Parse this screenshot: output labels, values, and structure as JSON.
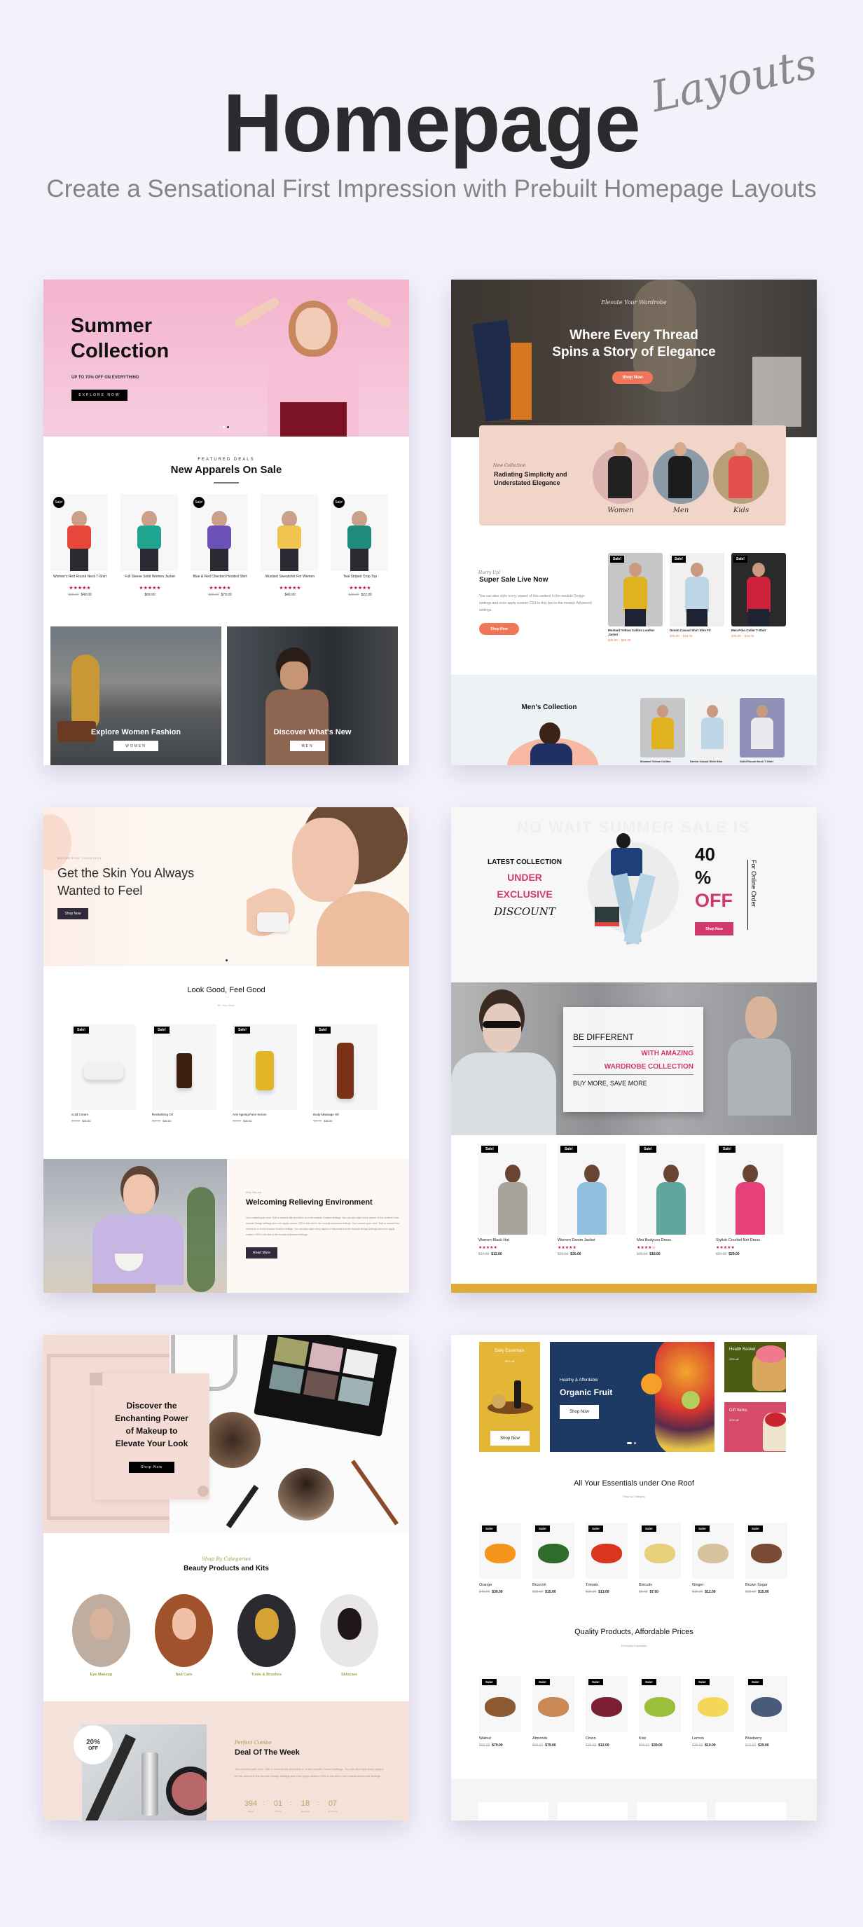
{
  "header": {
    "title": "Homepage",
    "script_word": "Layouts",
    "subtitle": "Create a Sensational First Impression with Prebuilt Homepage Layouts"
  },
  "layout1": {
    "hero": {
      "title_line1": "Summer",
      "title_line2": "Collection",
      "tagline": "UP TO 70% OFF ON EVERYTHING",
      "button": "EXPLORE NOW"
    },
    "featured_eyebrow": "FEATURED DEALS",
    "featured_title": "New Apparels On Sale",
    "products": [
      {
        "name": "Women's Red Round Neck T-Shirt",
        "old_price": "$59.00",
        "price": "$49.00",
        "sale": true,
        "stars": "★★★★★"
      },
      {
        "name": "Full Sleeve Solid Women Jacket",
        "old_price": "",
        "price": "$69.00",
        "sale": false,
        "stars": "★★★★★"
      },
      {
        "name": "Blue & Red Checked Hooded Shirt",
        "old_price": "$89.00",
        "price": "$79.00",
        "sale": true,
        "stars": "★★★★★"
      },
      {
        "name": "Mustard Sweatshirt For Women",
        "old_price": "",
        "price": "$49.00",
        "sale": false,
        "stars": "★★★★★"
      },
      {
        "name": "Teal Striped Crop Top",
        "old_price": "$30.00",
        "price": "$22.00",
        "sale": true,
        "stars": "★★★★★"
      }
    ],
    "sale_badge": "Sale!",
    "banners": [
      {
        "title": "Explore Women Fashion",
        "button": "WOMEN"
      },
      {
        "title": "Discover What's New",
        "button": "MEN"
      }
    ]
  },
  "layout2": {
    "hero": {
      "script": "Elevate Your Wardrobe",
      "title_line1": "Where Every Thread",
      "title_line2": "Spins a Story of Elegance",
      "button": "Shop Now"
    },
    "collection": {
      "script": "New Collection",
      "title_line1": "Radiating Simplicity and",
      "title_line2": "Understated Elegance",
      "categories": [
        "Women",
        "Men",
        "Kids"
      ]
    },
    "sale": {
      "script": "Hurry Up!",
      "title": "Super Sale Live Now",
      "body": "You can also style every aspect of this content in the module Design settings and even apply custom CSS to this text in the module Advanced settings.",
      "button": "Shop Now",
      "products": [
        {
          "name": "Mustard Yellow Collins Leather Jacket",
          "price": "$39.00 – $49.00"
        },
        {
          "name": "Denim Casual Shirt Slim Fit",
          "price": "$39.00 – $49.00"
        },
        {
          "name": "Men Polo Collar T-Shirt",
          "price": "$39.00 – $49.00"
        }
      ]
    },
    "mens": {
      "title": "Men's Collection",
      "products": [
        "Mustard Yellow Collins",
        "Denim Casual Shirt Slim",
        "Solid Round Neck T-Shirt"
      ]
    }
  },
  "layout3": {
    "hero": {
      "eyebrow": "MESMERIZE YOURSELF",
      "title_line1": "Get the Skin You Always",
      "title_line2": "Wanted to Feel",
      "button": "Shop Now"
    },
    "section_title": "Look Good, Feel Good",
    "section_sub": "Be Your Best!",
    "products": [
      {
        "name": "Cold Cream",
        "old_price": "$40.00",
        "price": "$30.00"
      },
      {
        "name": "Revitalizing Oil",
        "old_price": "$40.00",
        "price": "$30.00"
      },
      {
        "name": "Anti Ageing Face Serum",
        "old_price": "$40.00",
        "price": "$30.00"
      },
      {
        "name": "Body Massage Oil",
        "old_price": "$40.00",
        "price": "$30.00"
      }
    ],
    "about": {
      "eyebrow": "Who We Are",
      "title": "Welcoming Relieving Environment",
      "body": "Your content goes here. Edit or remove this text inline or in the module Content settings. You can also style every aspect of this content in the module Design settings and even apply custom CSS to this text in the module Advanced settings. Your content goes here. Edit or remove this text inline or in the module Content settings. You can also style every aspect of this content in the module Design settings and even apply custom CSS to this text in the module Advanced settings.",
      "button": "Read More"
    }
  },
  "layout4": {
    "hero": {
      "bg_text": "NO WAIT SUMMER SALE IS",
      "latest": "LATEST COLLECTION",
      "under": "UNDER",
      "exclusive": "EXCLUSIVE",
      "discount": "DISCOUNT",
      "percent": "40",
      "percent_sign": "%",
      "off": "OFF",
      "button": "Shop Now",
      "vertical": "For Online Order"
    },
    "promo": {
      "line1": "BE DIFFERENT",
      "line2": "WITH AMAZING",
      "line3": "WARDROBE COLLECTION",
      "line4": "BUY MORE, SAVE MORE"
    },
    "products": [
      {
        "name": "Women Black Hat",
        "old_price": "$17.00",
        "price": "$12.00",
        "stars": "★★★★★"
      },
      {
        "name": "Women Denim Jacket",
        "old_price": "$29.00",
        "price": "$20.00",
        "stars": "★★★★★"
      },
      {
        "name": "Mini Bodycon Dress",
        "old_price": "$25.00",
        "price": "$18.00",
        "stars": "★★★★☆"
      },
      {
        "name": "Stylish Crochet Net Dress",
        "old_price": "$34.00",
        "price": "$29.00",
        "stars": "★★★★★"
      }
    ]
  },
  "layout5": {
    "hero": {
      "title_line1": "Discover the",
      "title_line2": "Enchanting Power",
      "title_line3": "of Makeup to",
      "title_line4": "Elevate Your Look",
      "button": "Shop Now"
    },
    "categories_script": "Shop By Categories",
    "categories_title": "Beauty Products and Kits",
    "categories": [
      "Eye Makeup",
      "Nail Care",
      "Tools & Brushes",
      "Skincare"
    ],
    "deal": {
      "badge_pct": "20%",
      "badge_off": "OFF",
      "script": "Perfect Combo",
      "title": "Deal Of The Week",
      "body": "Your content goes here. Edit or remove this text inline or in the module Content settings. You can also style every aspect of this content in the module Design settings and even apply custom CSS to this text in the module Advanced settings.",
      "countdown": [
        {
          "value": "394",
          "label": "Day(s)"
        },
        {
          "value": "01",
          "label": "Hour(s)"
        },
        {
          "value": "18",
          "label": "Minute(s)"
        },
        {
          "value": "07",
          "label": "Second(s)"
        }
      ]
    }
  },
  "layout6": {
    "promo_left": {
      "title": "Daily Essentials",
      "discount": "50% off",
      "button": "Shop Now"
    },
    "promo_center": {
      "eyebrow": "Healthy & Affordable",
      "title": "Organic Fruit",
      "button": "Shop Now"
    },
    "promo_right_top": {
      "title": "Health Basket",
      "discount": "25% off"
    },
    "promo_right_bottom": {
      "title": "Gift Items",
      "discount": "20% off"
    },
    "section1_title": "All Your Essentials under One Roof",
    "section1_sub": "Shop by Category",
    "row1": [
      {
        "name": "Orange",
        "old_price": "$40.00",
        "price": "$30.00"
      },
      {
        "name": "Broccoli",
        "old_price": "$19.00",
        "price": "$15.00"
      },
      {
        "name": "Tomato",
        "old_price": "$15.00",
        "price": "$13.00"
      },
      {
        "name": "Biscuits",
        "old_price": "$9.00",
        "price": "$7.00"
      },
      {
        "name": "Ginger",
        "old_price": "$15.00",
        "price": "$12.00"
      },
      {
        "name": "Brown Sugar",
        "old_price": "$19.00",
        "price": "$15.00"
      }
    ],
    "section2_title": "Quality Products, Affordable Prices",
    "section2_sub": "Everyday Essentials",
    "row2": [
      {
        "name": "Walnut",
        "old_price": "$99.00",
        "price": "$79.00"
      },
      {
        "name": "Almonds",
        "old_price": "$99.00",
        "price": "$79.00"
      },
      {
        "name": "Onion",
        "old_price": "$15.00",
        "price": "$12.00"
      },
      {
        "name": "Kiwi",
        "old_price": "$49.00",
        "price": "$39.00"
      },
      {
        "name": "Lemon",
        "old_price": "$15.00",
        "price": "$10.00"
      },
      {
        "name": "Blueberry",
        "old_price": "$40.00",
        "price": "$29.00"
      }
    ],
    "sale_badge": "Sale!"
  },
  "colors": {
    "page_bg": "#f3f1fa",
    "pink_hero": "#f4b7cf",
    "coral": "#f0785a",
    "magenta": "#d23a6b",
    "navy": "#1c3a63",
    "mustard": "#e2b23a",
    "olive": "#4b5b12",
    "rose": "#d64a6a",
    "dark_button": "#2f2b3a"
  }
}
